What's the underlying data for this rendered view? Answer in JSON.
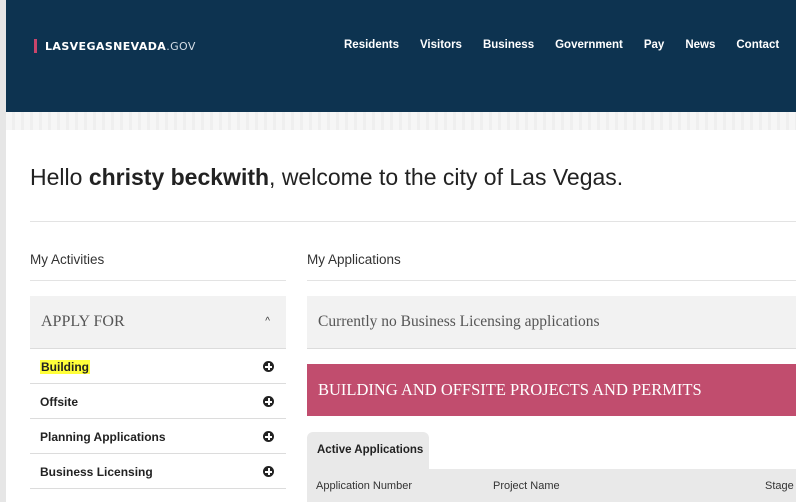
{
  "header": {
    "logo_main": "LASVEGASNEVADA",
    "logo_suffix": ".GOV",
    "nav": [
      "Residents",
      "Visitors",
      "Business",
      "Government",
      "Pay",
      "News",
      "Contact"
    ]
  },
  "greeting": {
    "prefix": "Hello ",
    "user": "christy beckwith",
    "suffix": ", welcome to the city of Las Vegas."
  },
  "activities": {
    "title": "My Activities",
    "apply_for": "APPLY FOR",
    "items": [
      "Building",
      "Offsite",
      "Planning Applications",
      "Business Licensing"
    ]
  },
  "applications": {
    "title": "My Applications",
    "no_apps": "Currently no Business Licensing applications",
    "section_title": "BUILDING AND OFFSITE PROJECTS AND PERMITS",
    "active_tab": "Active Applications",
    "columns": [
      "Application Number",
      "Project Name",
      "Stage"
    ]
  },
  "colors": {
    "header_bg": "#0d3350",
    "accent": "#c8456b",
    "section_bg": "#c14d6e",
    "highlight": "#ffff3a"
  }
}
